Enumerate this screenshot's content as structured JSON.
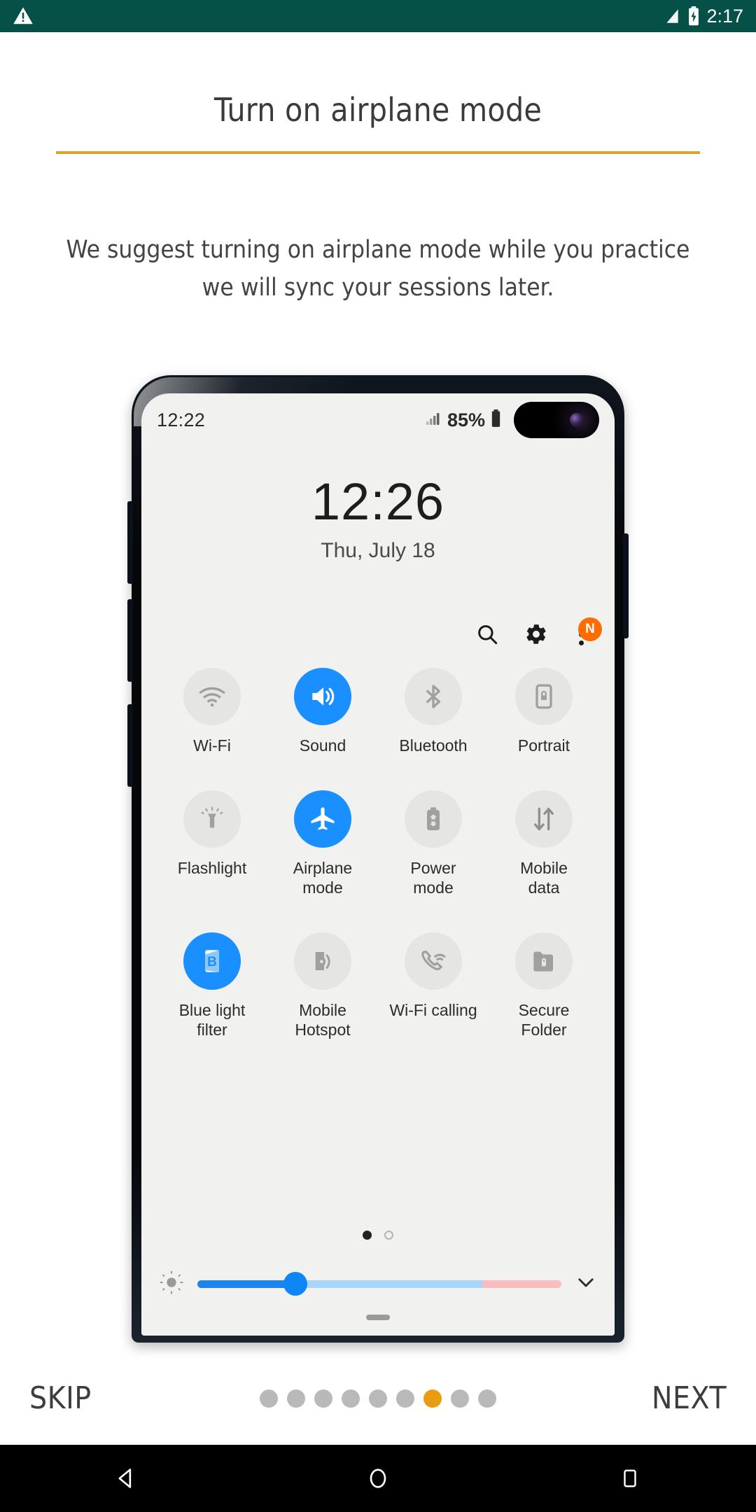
{
  "system_status_bar": {
    "warning_icon": "warning-triangle-icon",
    "signal_icon": "cellular-signal-icon",
    "battery_icon": "battery-charging-icon",
    "time": "2:17",
    "background_color": "#065147"
  },
  "page": {
    "title": "Turn on airplane mode",
    "rule_color": "#d9a528",
    "subtitle": "We suggest turning on airplane mode while you practice we will sync your sessions later."
  },
  "phone_mockup": {
    "status_bar": {
      "time": "12:22",
      "battery_percent": "85%",
      "signal_icon": "cellular-signal-icon",
      "battery_icon": "battery-icon",
      "camera_cutout": "punch-hole-camera"
    },
    "clock": {
      "time": "12:26",
      "date": "Thu, July 18"
    },
    "actions": [
      {
        "name": "search-icon",
        "label": "Search"
      },
      {
        "name": "gear-icon",
        "label": "Settings"
      },
      {
        "name": "overflow-menu-icon",
        "label": "More options",
        "badge": "N",
        "badge_color": "#ff6d00"
      }
    ],
    "tiles": [
      {
        "label": "Wi-Fi",
        "icon": "wifi-icon",
        "active": false
      },
      {
        "label": "Sound",
        "icon": "sound-icon",
        "active": true
      },
      {
        "label": "Bluetooth",
        "icon": "bluetooth-icon",
        "active": false
      },
      {
        "label": "Portrait",
        "icon": "portrait-lock-icon",
        "active": false
      },
      {
        "label": "Flashlight",
        "icon": "flashlight-icon",
        "active": false
      },
      {
        "label": "Airplane\nmode",
        "icon": "airplane-icon",
        "active": true
      },
      {
        "label": "Power\nmode",
        "icon": "power-mode-icon",
        "active": false
      },
      {
        "label": "Mobile\ndata",
        "icon": "mobile-data-icon",
        "active": false
      },
      {
        "label": "Blue light\nfilter",
        "icon": "blue-light-filter-icon",
        "active": true
      },
      {
        "label": "Mobile\nHotspot",
        "icon": "mobile-hotspot-icon",
        "active": false
      },
      {
        "label": "Wi-Fi calling",
        "icon": "wifi-calling-icon",
        "active": false
      },
      {
        "label": "Secure\nFolder",
        "icon": "secure-folder-icon",
        "active": false
      }
    ],
    "panel_pages": {
      "count": 2,
      "active_index": 0
    },
    "brightness": {
      "icon": "brightness-sun-icon",
      "value_percent": 27,
      "fill_color": "#1a85f0",
      "track_color": "#a8d6fb",
      "warm_color": "#f9bdbd",
      "expand_icon": "chevron-down-icon"
    },
    "active_tile_color": "#1a8fff",
    "inactive_tile_color": "#e5e5e3"
  },
  "footer": {
    "skip_label": "SKIP",
    "next_label": "NEXT",
    "pager": {
      "count": 9,
      "active_index": 6,
      "active_color": "#e89c12",
      "inactive_color": "#b9b9b9"
    }
  },
  "navigation_bar": {
    "back": "back-triangle-icon",
    "home": "home-circle-icon",
    "recents": "recents-square-icon"
  }
}
